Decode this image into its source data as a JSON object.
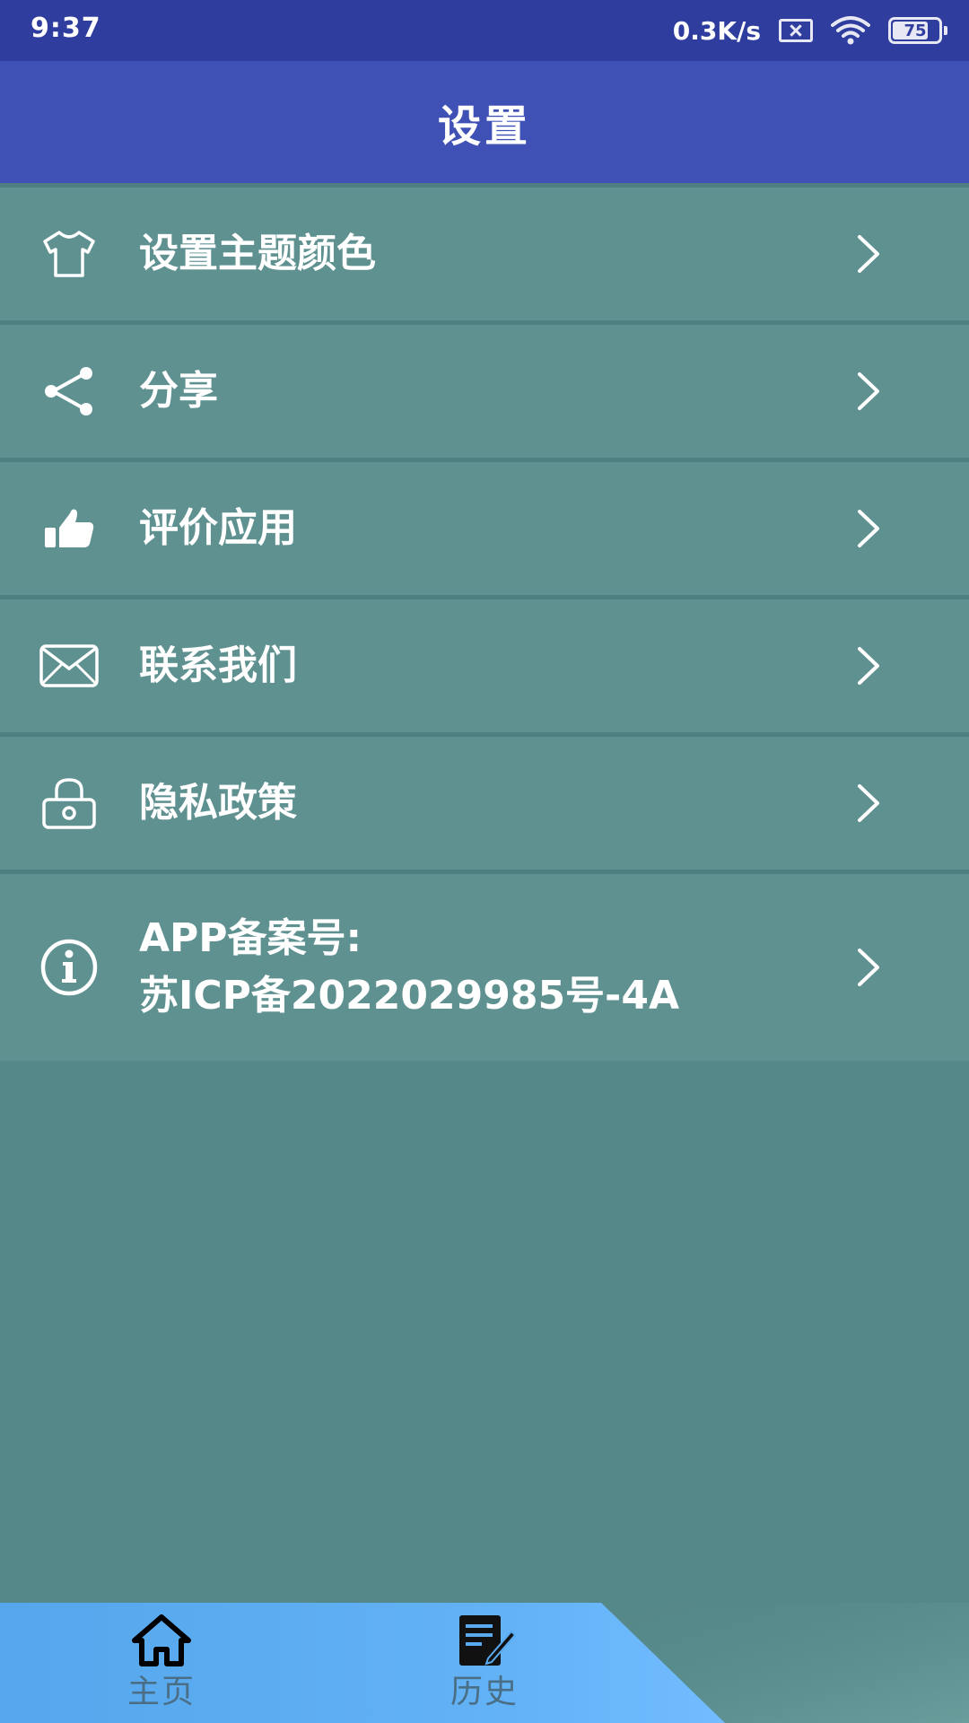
{
  "status_bar": {
    "time": "9:37",
    "net_speed": "0.3K/s",
    "battery": "75",
    "battery_level": 0.75,
    "icons": [
      "sim-missing-icon",
      "wifi-icon",
      "battery-icon"
    ]
  },
  "app_bar": {
    "title": "设置"
  },
  "settings": {
    "items": [
      {
        "label": "设置主题颜色",
        "icon": "shirt-icon"
      },
      {
        "label": "分享",
        "icon": "share-icon"
      },
      {
        "label": "评价应用",
        "icon": "thumbs-up-icon"
      },
      {
        "label": "联系我们",
        "icon": "mail-icon"
      },
      {
        "label": "隐私政策",
        "icon": "lock-icon"
      },
      {
        "label_line1": "APP备案号:",
        "label_line2": "苏ICP备2022029985号-4A",
        "icon": "info-icon"
      }
    ]
  },
  "bottom_nav": {
    "items": [
      {
        "label": "主页",
        "icon": "home-icon"
      },
      {
        "label": "历史",
        "icon": "history-edit-icon"
      }
    ]
  },
  "colors": {
    "status_bar": "#2f3e9e",
    "app_bar": "#3f51b5",
    "list_item": "#5e9190",
    "page_background": "#558889",
    "bottom_nav": "#5aaaf0"
  }
}
